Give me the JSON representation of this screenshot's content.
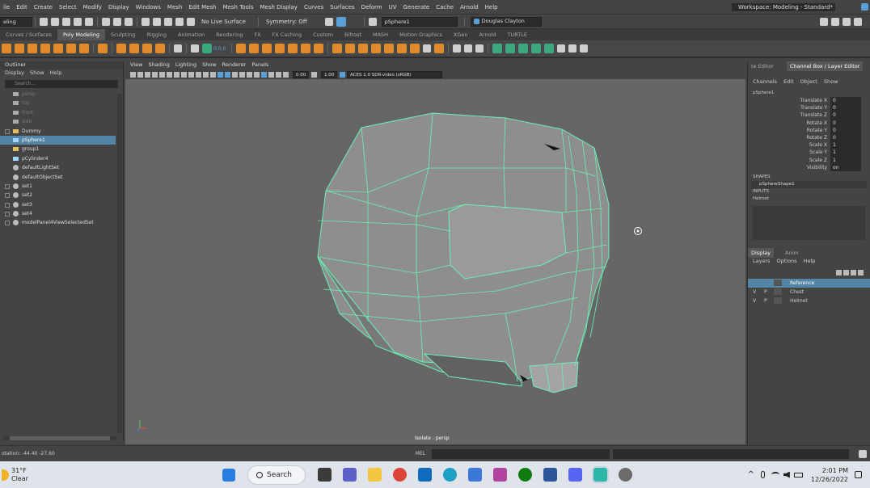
{
  "menubar": {
    "items": [
      "ile",
      "Edit",
      "Create",
      "Select",
      "Modify",
      "Display",
      "Windows",
      "Mesh",
      "Edit Mesh",
      "Mesh Tools",
      "Mesh Display",
      "Curves",
      "Surfaces",
      "Deform",
      "UV",
      "Generate",
      "Cache",
      "Arnold",
      "Help"
    ],
    "workspace": "Workspace: Modeling - Standard*"
  },
  "statusline": {
    "mode": "eling",
    "live_surface": "No Live Surface",
    "symmetry": "Symmetry: Off",
    "selection_field": "pSphere1",
    "user": "Douglas Clayton"
  },
  "shelf": {
    "tabs": [
      "Curves / Surfaces",
      "Poly Modeling",
      "Sculpting",
      "Rigging",
      "Animation",
      "Rendering",
      "FX",
      "FX Caching",
      "Custom",
      "Bifrost",
      "MASH",
      "Motion Graphics",
      "XGen",
      "Arnold",
      "TURTLE"
    ],
    "active": "Poly Modeling",
    "coord_label": "0,0,0"
  },
  "outliner": {
    "title": "Outliner",
    "menus": [
      "Display",
      "Show",
      "Help"
    ],
    "search_placeholder": "Search...",
    "items": [
      {
        "label": "persp",
        "kind": "camera",
        "dim": true
      },
      {
        "label": "top",
        "kind": "camera",
        "dim": true
      },
      {
        "label": "front",
        "kind": "camera",
        "dim": true
      },
      {
        "label": "side",
        "kind": "camera",
        "dim": true
      },
      {
        "label": "Dummy",
        "kind": "group",
        "expand": true
      },
      {
        "label": "pSphere1",
        "kind": "mesh",
        "selected": true
      },
      {
        "label": "group1",
        "kind": "group"
      },
      {
        "label": "pCylinder4",
        "kind": "mesh"
      },
      {
        "label": "defaultLightSet",
        "kind": "set"
      },
      {
        "label": "defaultObjectSet",
        "kind": "set"
      },
      {
        "label": "set1",
        "kind": "set",
        "expand": true
      },
      {
        "label": "set2",
        "kind": "set",
        "expand": true
      },
      {
        "label": "set3",
        "kind": "set",
        "expand": true
      },
      {
        "label": "set4",
        "kind": "set",
        "expand": true
      },
      {
        "label": "modelPanel4ViewSelectedSet",
        "kind": "set",
        "expand": true
      }
    ]
  },
  "viewport": {
    "menus": [
      "View",
      "Shading",
      "Lighting",
      "Show",
      "Renderer",
      "Panels"
    ],
    "exposure": "0.00",
    "gamma": "1.00",
    "colorspace": "ACES 1.0 SDR-video (sRGB)",
    "isolate_label": "Isolate : persp"
  },
  "channelbox": {
    "tabs": [
      "te Editor",
      "Channel Box / Layer Editor"
    ],
    "menus": [
      "Channels",
      "Edit",
      "Object",
      "Show"
    ],
    "object": "pSphere1",
    "attributes": [
      {
        "name": "Translate X",
        "value": "0"
      },
      {
        "name": "Translate Y",
        "value": "0"
      },
      {
        "name": "Translate Z",
        "value": "0"
      },
      {
        "name": "Rotate X",
        "value": "0"
      },
      {
        "name": "Rotate Y",
        "value": "0"
      },
      {
        "name": "Rotate Z",
        "value": "0"
      },
      {
        "name": "Scale X",
        "value": "1"
      },
      {
        "name": "Scale Y",
        "value": "1"
      },
      {
        "name": "Scale Z",
        "value": "1"
      },
      {
        "name": "Visibility",
        "value": "on"
      }
    ],
    "shapes_label": "SHAPES",
    "shape": "pSphereShape1",
    "inputs_label": "INPUTS",
    "input": "Helmet"
  },
  "layers": {
    "tabs": [
      "Display",
      "Anim"
    ],
    "menus": [
      "Layers",
      "Options",
      "Help"
    ],
    "rows": [
      {
        "v": "",
        "p": "",
        "name": "Reference",
        "selected": true
      },
      {
        "v": "V",
        "p": "P",
        "name": "Chest"
      },
      {
        "v": "V",
        "p": "P",
        "name": "Helmet"
      }
    ]
  },
  "bottombar": {
    "rotation": "otation:  -44.40   -27.60",
    "mel": "MEL"
  },
  "taskbar": {
    "temp": "31°F",
    "weather": "Clear",
    "search": "Search",
    "time": "2:01 PM",
    "date": "12/26/2022"
  }
}
